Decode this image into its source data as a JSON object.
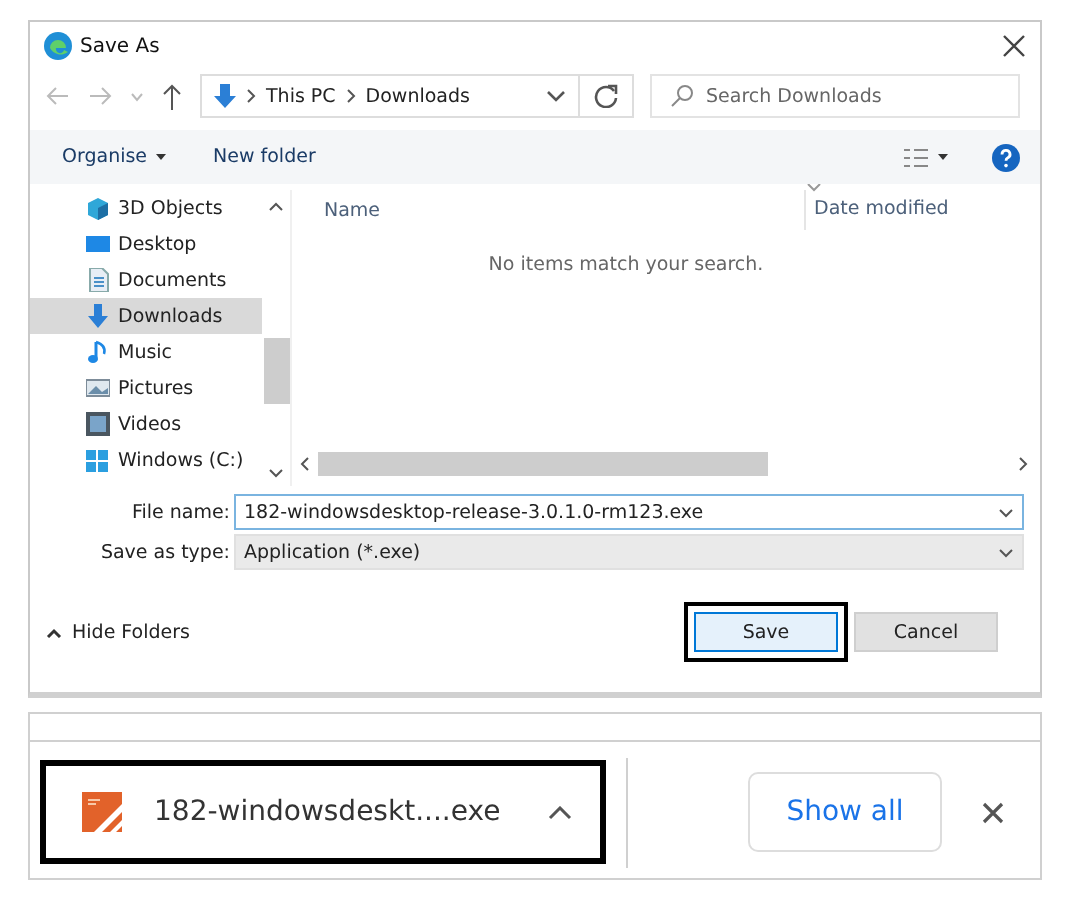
{
  "window": {
    "title": "Save As"
  },
  "address": {
    "path": [
      "This PC",
      "Downloads"
    ],
    "search_placeholder": "Search Downloads"
  },
  "toolbar": {
    "organise": "Organise",
    "new_folder": "New folder"
  },
  "sidebar": {
    "items": [
      {
        "label": "3D Objects",
        "selected": false
      },
      {
        "label": "Desktop",
        "selected": false
      },
      {
        "label": "Documents",
        "selected": false
      },
      {
        "label": "Downloads",
        "selected": true
      },
      {
        "label": "Music",
        "selected": false
      },
      {
        "label": "Pictures",
        "selected": false
      },
      {
        "label": "Videos",
        "selected": false
      },
      {
        "label": "Windows (C:)",
        "selected": false
      }
    ]
  },
  "file_list": {
    "columns": [
      "Name",
      "Date modified"
    ],
    "empty_message": "No items match your search."
  },
  "form": {
    "file_name_label": "File name:",
    "file_name": "182-windowsdesktop-release-3.0.1.0-rm123.exe",
    "type_label": "Save as type:",
    "type": "Application (*.exe)"
  },
  "footer": {
    "hide_folders": "Hide Folders",
    "buttons": [
      {
        "label": "Save",
        "highlighted": true
      },
      {
        "label": "Cancel",
        "highlighted": false
      }
    ]
  },
  "download_bar": {
    "file": "182-windowsdeskt....exe",
    "highlighted": true,
    "show_all": "Show all"
  }
}
